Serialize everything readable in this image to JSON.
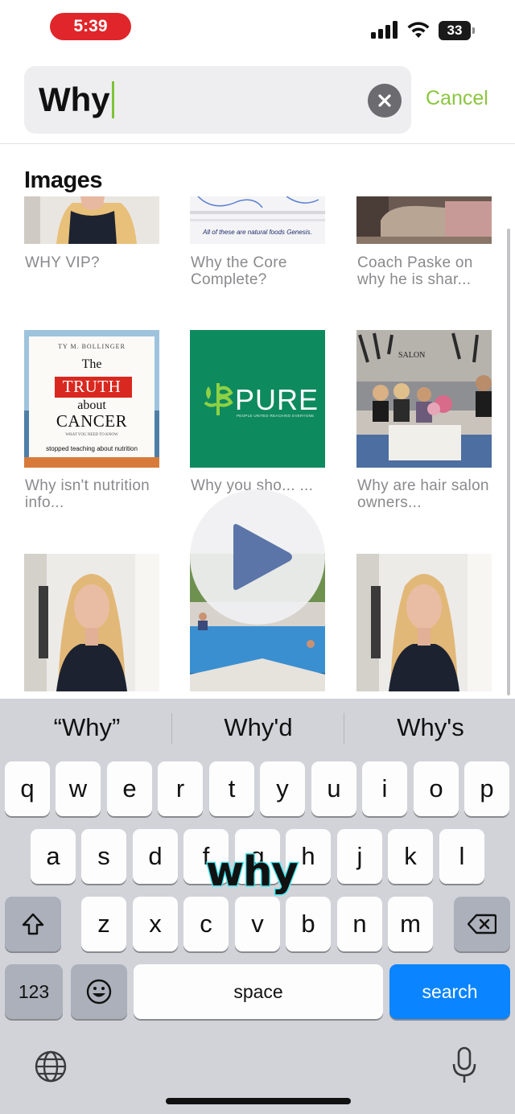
{
  "status_bar": {
    "time": "5:39",
    "battery": "33"
  },
  "search": {
    "query": "Why",
    "cancel_label": "Cancel"
  },
  "section": {
    "title": "Images"
  },
  "results": [
    {
      "caption": "WHY VIP?"
    },
    {
      "caption": "Why the Core Complete?",
      "thumb_text": "All of these are natural foods Genesis."
    },
    {
      "caption": "Coach Paske on why he is shar..."
    },
    {
      "caption": "Why isn't nutrition info...",
      "book": {
        "author": "TY M. BOLLINGER",
        "the": "The",
        "truth": "TRUTH",
        "about": "about",
        "cancer": "CANCER",
        "sub": "WHAT YOU NEED TO KNOW",
        "overlay": "stopped teaching about nutrition"
      }
    },
    {
      "caption": "Why you sho... ...",
      "logo": "PURE",
      "logo_tag": "PEOPLE UNITED REACHING EVERYONE"
    },
    {
      "caption": "Why are hair salon owners...",
      "sign": "SALON"
    },
    {
      "caption": ""
    },
    {
      "caption": ""
    },
    {
      "caption": ""
    }
  ],
  "keyboard": {
    "suggestions": [
      "“Why”",
      "Why'd",
      "Why's"
    ],
    "row1": [
      "q",
      "w",
      "e",
      "r",
      "t",
      "y",
      "u",
      "i",
      "o",
      "p"
    ],
    "row2": [
      "a",
      "s",
      "d",
      "f",
      "g",
      "h",
      "j",
      "k",
      "l"
    ],
    "row3": [
      "z",
      "x",
      "c",
      "v",
      "b",
      "n",
      "m"
    ],
    "numbers_label": "123",
    "space_label": "space",
    "search_label": "search"
  },
  "video_overlay_word": "why",
  "colors": {
    "accent": "#8cc63f",
    "time_pill": "#e0262a",
    "search_key": "#0a84ff"
  }
}
